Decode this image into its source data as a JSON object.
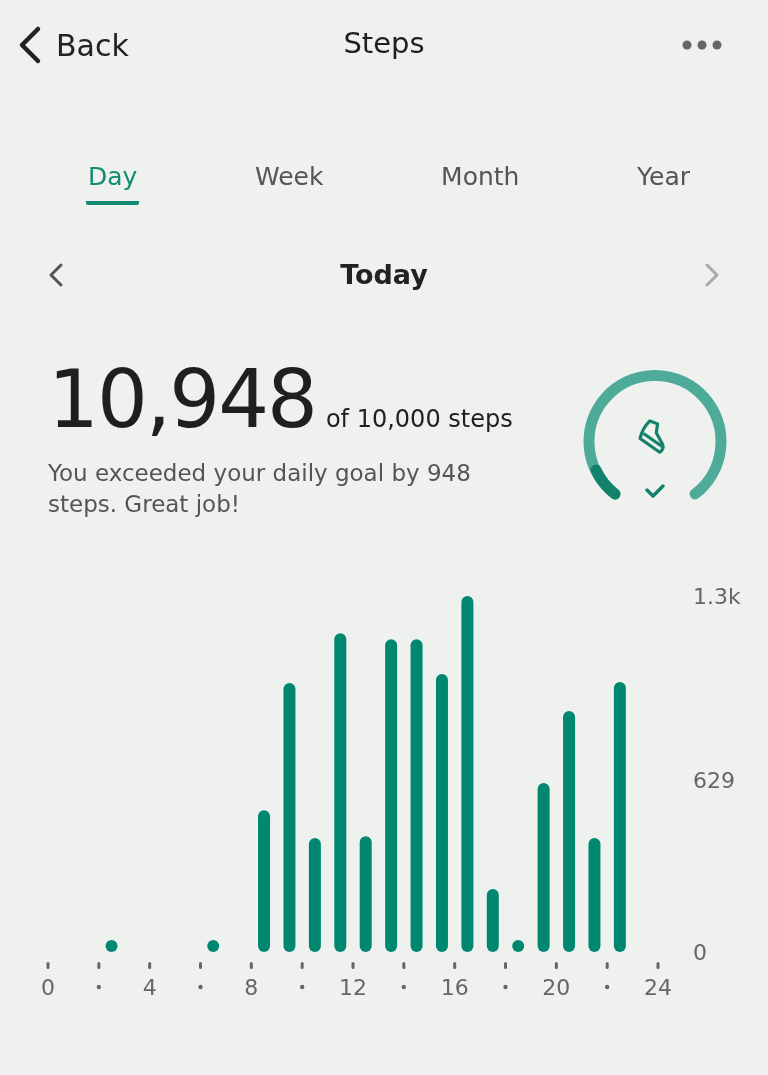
{
  "header": {
    "back_label": "Back",
    "title": "Steps"
  },
  "tabs": [
    {
      "label": "Day",
      "selected": true
    },
    {
      "label": "Week",
      "selected": false
    },
    {
      "label": "Month",
      "selected": false
    },
    {
      "label": "Year",
      "selected": false
    }
  ],
  "period": {
    "label": "Today",
    "next_disabled": true
  },
  "summary": {
    "count": "10,948",
    "goal": "of 10,000 steps",
    "message": "You exceeded your daily goal by 948 steps. Great job!",
    "goal_met": true
  },
  "chart_data": {
    "type": "bar",
    "x": [
      2.5,
      6.5,
      8.5,
      9.5,
      10.5,
      11.5,
      12.5,
      13.5,
      14.5,
      15.5,
      16.5,
      17.5,
      18.5,
      19.5,
      20.5,
      21.5,
      22.5
    ],
    "series": [
      {
        "color": "#00876f",
        "values": [
          40,
          40,
          518,
          982,
          416,
          1164,
          423,
          1142,
          1142,
          1015,
          1300,
          230,
          40,
          617,
          880,
          416,
          986
        ]
      }
    ],
    "xlim": [
      0,
      24
    ],
    "ylim": [
      0,
      1300
    ],
    "yticks": [
      0,
      629,
      {
        "value": 1300,
        "label": "1.3k"
      }
    ],
    "xticks": [
      0,
      4,
      8,
      12,
      16,
      20,
      24
    ]
  }
}
